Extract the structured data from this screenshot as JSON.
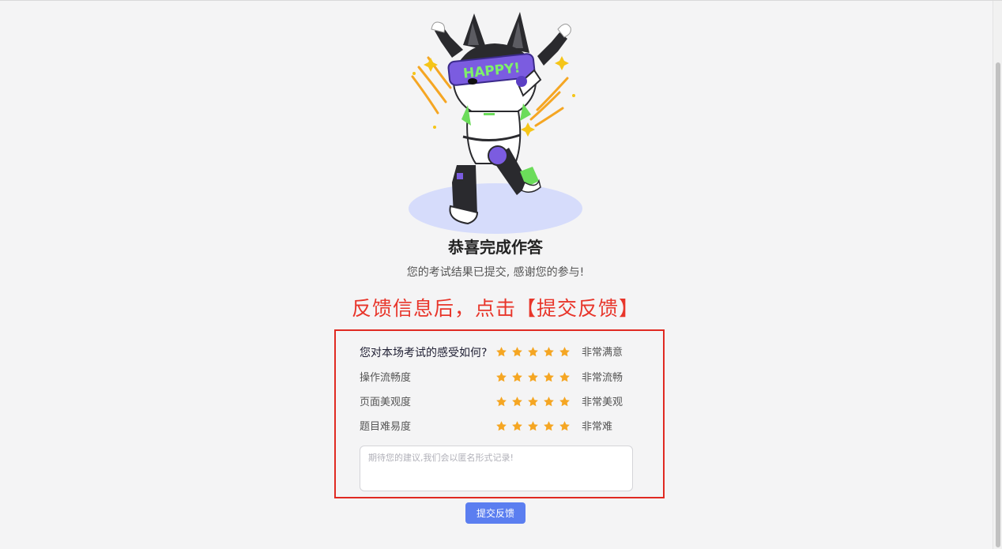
{
  "congrats": {
    "title": "恭喜完成作答",
    "subtitle": "您的考试结果已提交, 感谢您的参与!",
    "mascot_text": "HAPPY!"
  },
  "annotation": "反馈信息后，点击【提交反馈】",
  "feedback": {
    "ratings": [
      {
        "label": "您对本场考试的感受如何?",
        "stars": 5,
        "max": 5,
        "value_text": "非常满意"
      },
      {
        "label": "操作流畅度",
        "stars": 5,
        "max": 5,
        "value_text": "非常流畅"
      },
      {
        "label": "页面美观度",
        "stars": 5,
        "max": 5,
        "value_text": "非常美观"
      },
      {
        "label": "题目难易度",
        "stars": 5,
        "max": 5,
        "value_text": "非常难"
      }
    ],
    "suggestion_placeholder": "期待您的建议,我们会以匿名形式记录!",
    "suggestion_value": "",
    "submit_label": "提交反馈"
  },
  "colors": {
    "star": "#f5a623",
    "annotation": "#e8352a",
    "highlight_border": "#e02a22",
    "button": "#5b7ef0",
    "mascot_ground": "#d6dcfb"
  },
  "icons": {
    "star": "star-icon",
    "mascot": "robot-mascot-illustration"
  }
}
